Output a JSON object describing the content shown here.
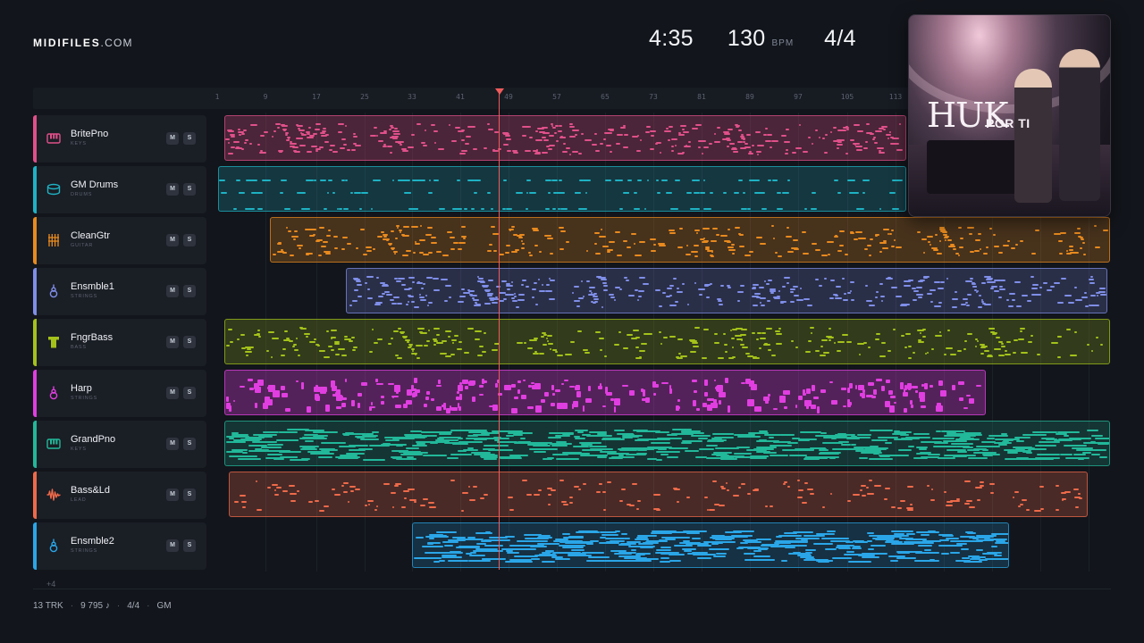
{
  "header": {
    "brand": "MIDIFILES",
    "domain": ".COM"
  },
  "stats": {
    "duration": "4:35",
    "tempo": "130",
    "tempo_unit": "BPM",
    "time_signature": "4/4"
  },
  "album": {
    "title": "HUK",
    "subtitle": "POR TI"
  },
  "ruler": {
    "ticks": [
      "1",
      "9",
      "17",
      "25",
      "33",
      "41",
      "49",
      "57",
      "65",
      "73",
      "81",
      "89",
      "97",
      "105",
      "113"
    ]
  },
  "tracks": [
    {
      "name": "BritePno",
      "category": "KEYS",
      "color": "#e0508a",
      "icon": "piano-keys-icon",
      "mute": "M",
      "solo": "S"
    },
    {
      "name": "GM Drums",
      "category": "DRUMS",
      "color": "#1eb3c4",
      "icon": "drum-icon",
      "mute": "M",
      "solo": "S"
    },
    {
      "name": "CleanGtr",
      "category": "GUITAR",
      "color": "#e88a1e",
      "icon": "guitar-fretboard-icon",
      "mute": "M",
      "solo": "S"
    },
    {
      "name": "Ensmble1",
      "category": "STRINGS",
      "color": "#7f8ee8",
      "icon": "violin-icon",
      "mute": "M",
      "solo": "S"
    },
    {
      "name": "FngrBass",
      "category": "BASS",
      "color": "#a4c21a",
      "icon": "bass-icon",
      "mute": "M",
      "solo": "S"
    },
    {
      "name": "Harp",
      "category": "STRINGS",
      "color": "#e03ee0",
      "icon": "violin-icon",
      "mute": "M",
      "solo": "S"
    },
    {
      "name": "GrandPno",
      "category": "KEYS",
      "color": "#22b89a",
      "icon": "piano-keys-icon",
      "mute": "M",
      "solo": "S"
    },
    {
      "name": "Bass&Ld",
      "category": "LEAD",
      "color": "#ee6a4a",
      "icon": "waveform-icon",
      "mute": "M",
      "solo": "S"
    },
    {
      "name": "Ensmble2",
      "category": "STRINGS",
      "color": "#2aa6e8",
      "icon": "violin-icon",
      "mute": "M",
      "solo": "S"
    }
  ],
  "more_tracks": "+4",
  "footer": {
    "tracks": "13 TRK",
    "notes": "9 795 ♪",
    "meter": "4/4",
    "standard": "GM"
  }
}
